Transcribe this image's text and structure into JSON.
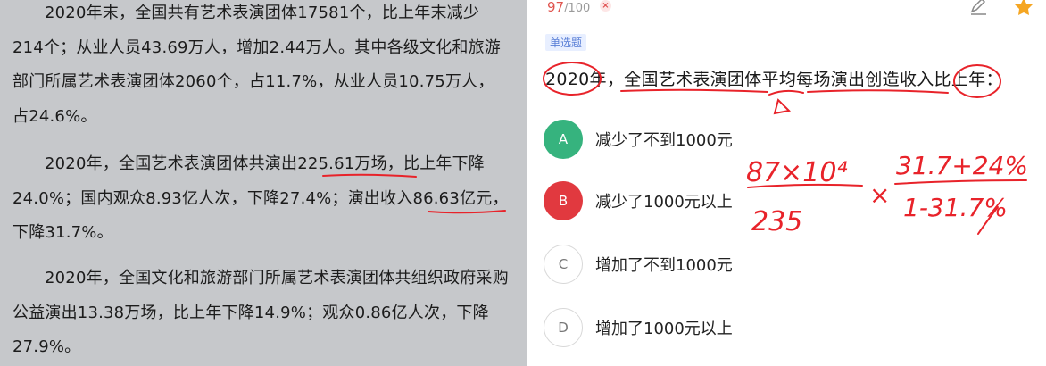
{
  "passage": {
    "paragraphs": [
      "2020年末，全国共有艺术表演团体17581个，比上年末减少214个；从业人员43.69万人，增加2.44万人。其中各级文化和旅游部门所属艺术表演团体2060个，占11.7%，从业人员10.75万人，占24.6%。",
      "2020年，全国艺术表演团体共演出225.61万场，比上年下降24.0%；国内观众8.93亿人次，下降27.4%；演出收入86.63亿元，下降31.7%。",
      "2020年，全国文化和旅游部门所属艺术表演团体共组织政府采购公益演出13.38万场，比上年下降14.9%；观众0.86亿人次，下降27.9%。"
    ]
  },
  "header": {
    "progress_current": "97",
    "progress_total": "/100",
    "wrong_mark": "×"
  },
  "icons": {
    "edit": "edit-icon",
    "favorite": "star-icon"
  },
  "question": {
    "type_label": "单选题",
    "stem": "2020年，全国艺术表演团体平均每场演出创造收入比上年：",
    "options": [
      {
        "letter": "A",
        "text": "减少了不到1000元",
        "state": "correct"
      },
      {
        "letter": "B",
        "text": "减少了1000元以上",
        "state": "wrong"
      },
      {
        "letter": "C",
        "text": "增加了不到1000元",
        "state": "normal"
      },
      {
        "letter": "D",
        "text": "增加了1000元以上",
        "state": "normal"
      }
    ]
  },
  "annotations": {
    "handwriting_1": "87×10⁴",
    "handwriting_2": "235",
    "handwriting_3": "×",
    "handwriting_4": "31.7+24%",
    "handwriting_5": "1-31.7%"
  },
  "colors": {
    "correct": "#36b37e",
    "wrong": "#e1393f",
    "ink": "#e8232a",
    "accent": "#5a7fd6"
  }
}
